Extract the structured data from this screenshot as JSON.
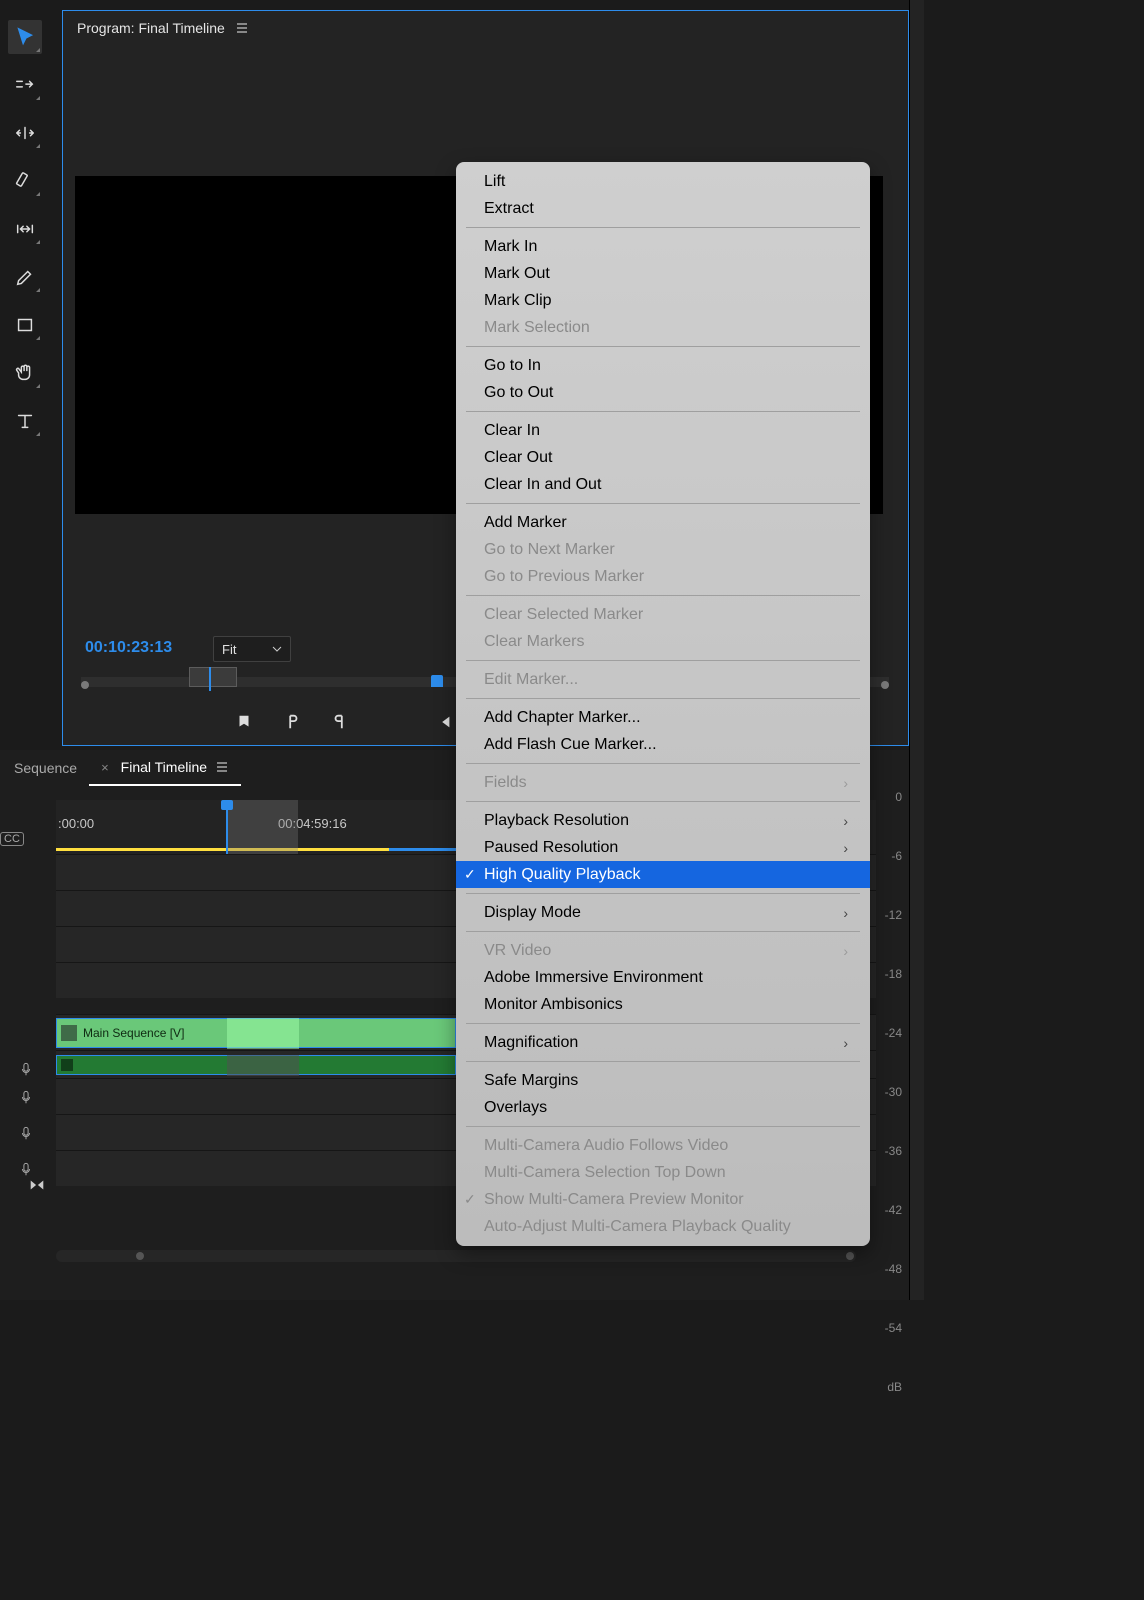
{
  "program": {
    "title": "Program: Final Timeline",
    "timecode": "00:10:23:13",
    "zoom_label": "Fit"
  },
  "timeline": {
    "tab_inactive": "Sequence",
    "tab_active": "Final Timeline",
    "ruler_times": [
      ":00:00",
      "00:04:59:16"
    ],
    "clip_name": "Main Sequence  [V]",
    "cc_label": "CC"
  },
  "meter_labels": [
    "0",
    "-6",
    "-12",
    "-18",
    "-24",
    "-30",
    "-36",
    "-42",
    "-48",
    "-54",
    "dB"
  ],
  "context_menu": {
    "groups": [
      [
        {
          "label": "Lift",
          "disabled": false
        },
        {
          "label": "Extract",
          "disabled": false
        }
      ],
      [
        {
          "label": "Mark In",
          "disabled": false
        },
        {
          "label": "Mark Out",
          "disabled": false
        },
        {
          "label": "Mark Clip",
          "disabled": false
        },
        {
          "label": "Mark Selection",
          "disabled": true
        }
      ],
      [
        {
          "label": "Go to In",
          "disabled": false
        },
        {
          "label": "Go to Out",
          "disabled": false
        }
      ],
      [
        {
          "label": "Clear In",
          "disabled": false
        },
        {
          "label": "Clear Out",
          "disabled": false
        },
        {
          "label": "Clear In and Out",
          "disabled": false
        }
      ],
      [
        {
          "label": "Add Marker",
          "disabled": false
        },
        {
          "label": "Go to Next Marker",
          "disabled": true
        },
        {
          "label": "Go to Previous Marker",
          "disabled": true
        }
      ],
      [
        {
          "label": "Clear Selected Marker",
          "disabled": true
        },
        {
          "label": "Clear Markers",
          "disabled": true
        }
      ],
      [
        {
          "label": "Edit Marker...",
          "disabled": true
        }
      ],
      [
        {
          "label": "Add Chapter Marker...",
          "disabled": false
        },
        {
          "label": "Add Flash Cue Marker...",
          "disabled": false
        }
      ],
      [
        {
          "label": "Fields",
          "disabled": true,
          "submenu": true
        }
      ],
      [
        {
          "label": "Playback Resolution",
          "disabled": false,
          "submenu": true
        },
        {
          "label": "Paused Resolution",
          "disabled": false,
          "submenu": true
        },
        {
          "label": "High Quality Playback",
          "disabled": false,
          "checked": true,
          "hovered": true
        }
      ],
      [
        {
          "label": "Display Mode",
          "disabled": false,
          "submenu": true
        }
      ],
      [
        {
          "label": "VR Video",
          "disabled": true,
          "submenu": true
        },
        {
          "label": "Adobe Immersive Environment",
          "disabled": false
        },
        {
          "label": "Monitor Ambisonics",
          "disabled": false
        }
      ],
      [
        {
          "label": "Magnification",
          "disabled": false,
          "submenu": true
        }
      ],
      [
        {
          "label": "Safe Margins",
          "disabled": false
        },
        {
          "label": "Overlays",
          "disabled": false
        }
      ],
      [
        {
          "label": "Multi-Camera Audio Follows Video",
          "disabled": true
        },
        {
          "label": "Multi-Camera Selection Top Down",
          "disabled": true
        },
        {
          "label": "Show Multi-Camera Preview Monitor",
          "disabled": true,
          "checked": true
        },
        {
          "label": "Auto-Adjust Multi-Camera Playback Quality",
          "disabled": true
        }
      ]
    ]
  }
}
